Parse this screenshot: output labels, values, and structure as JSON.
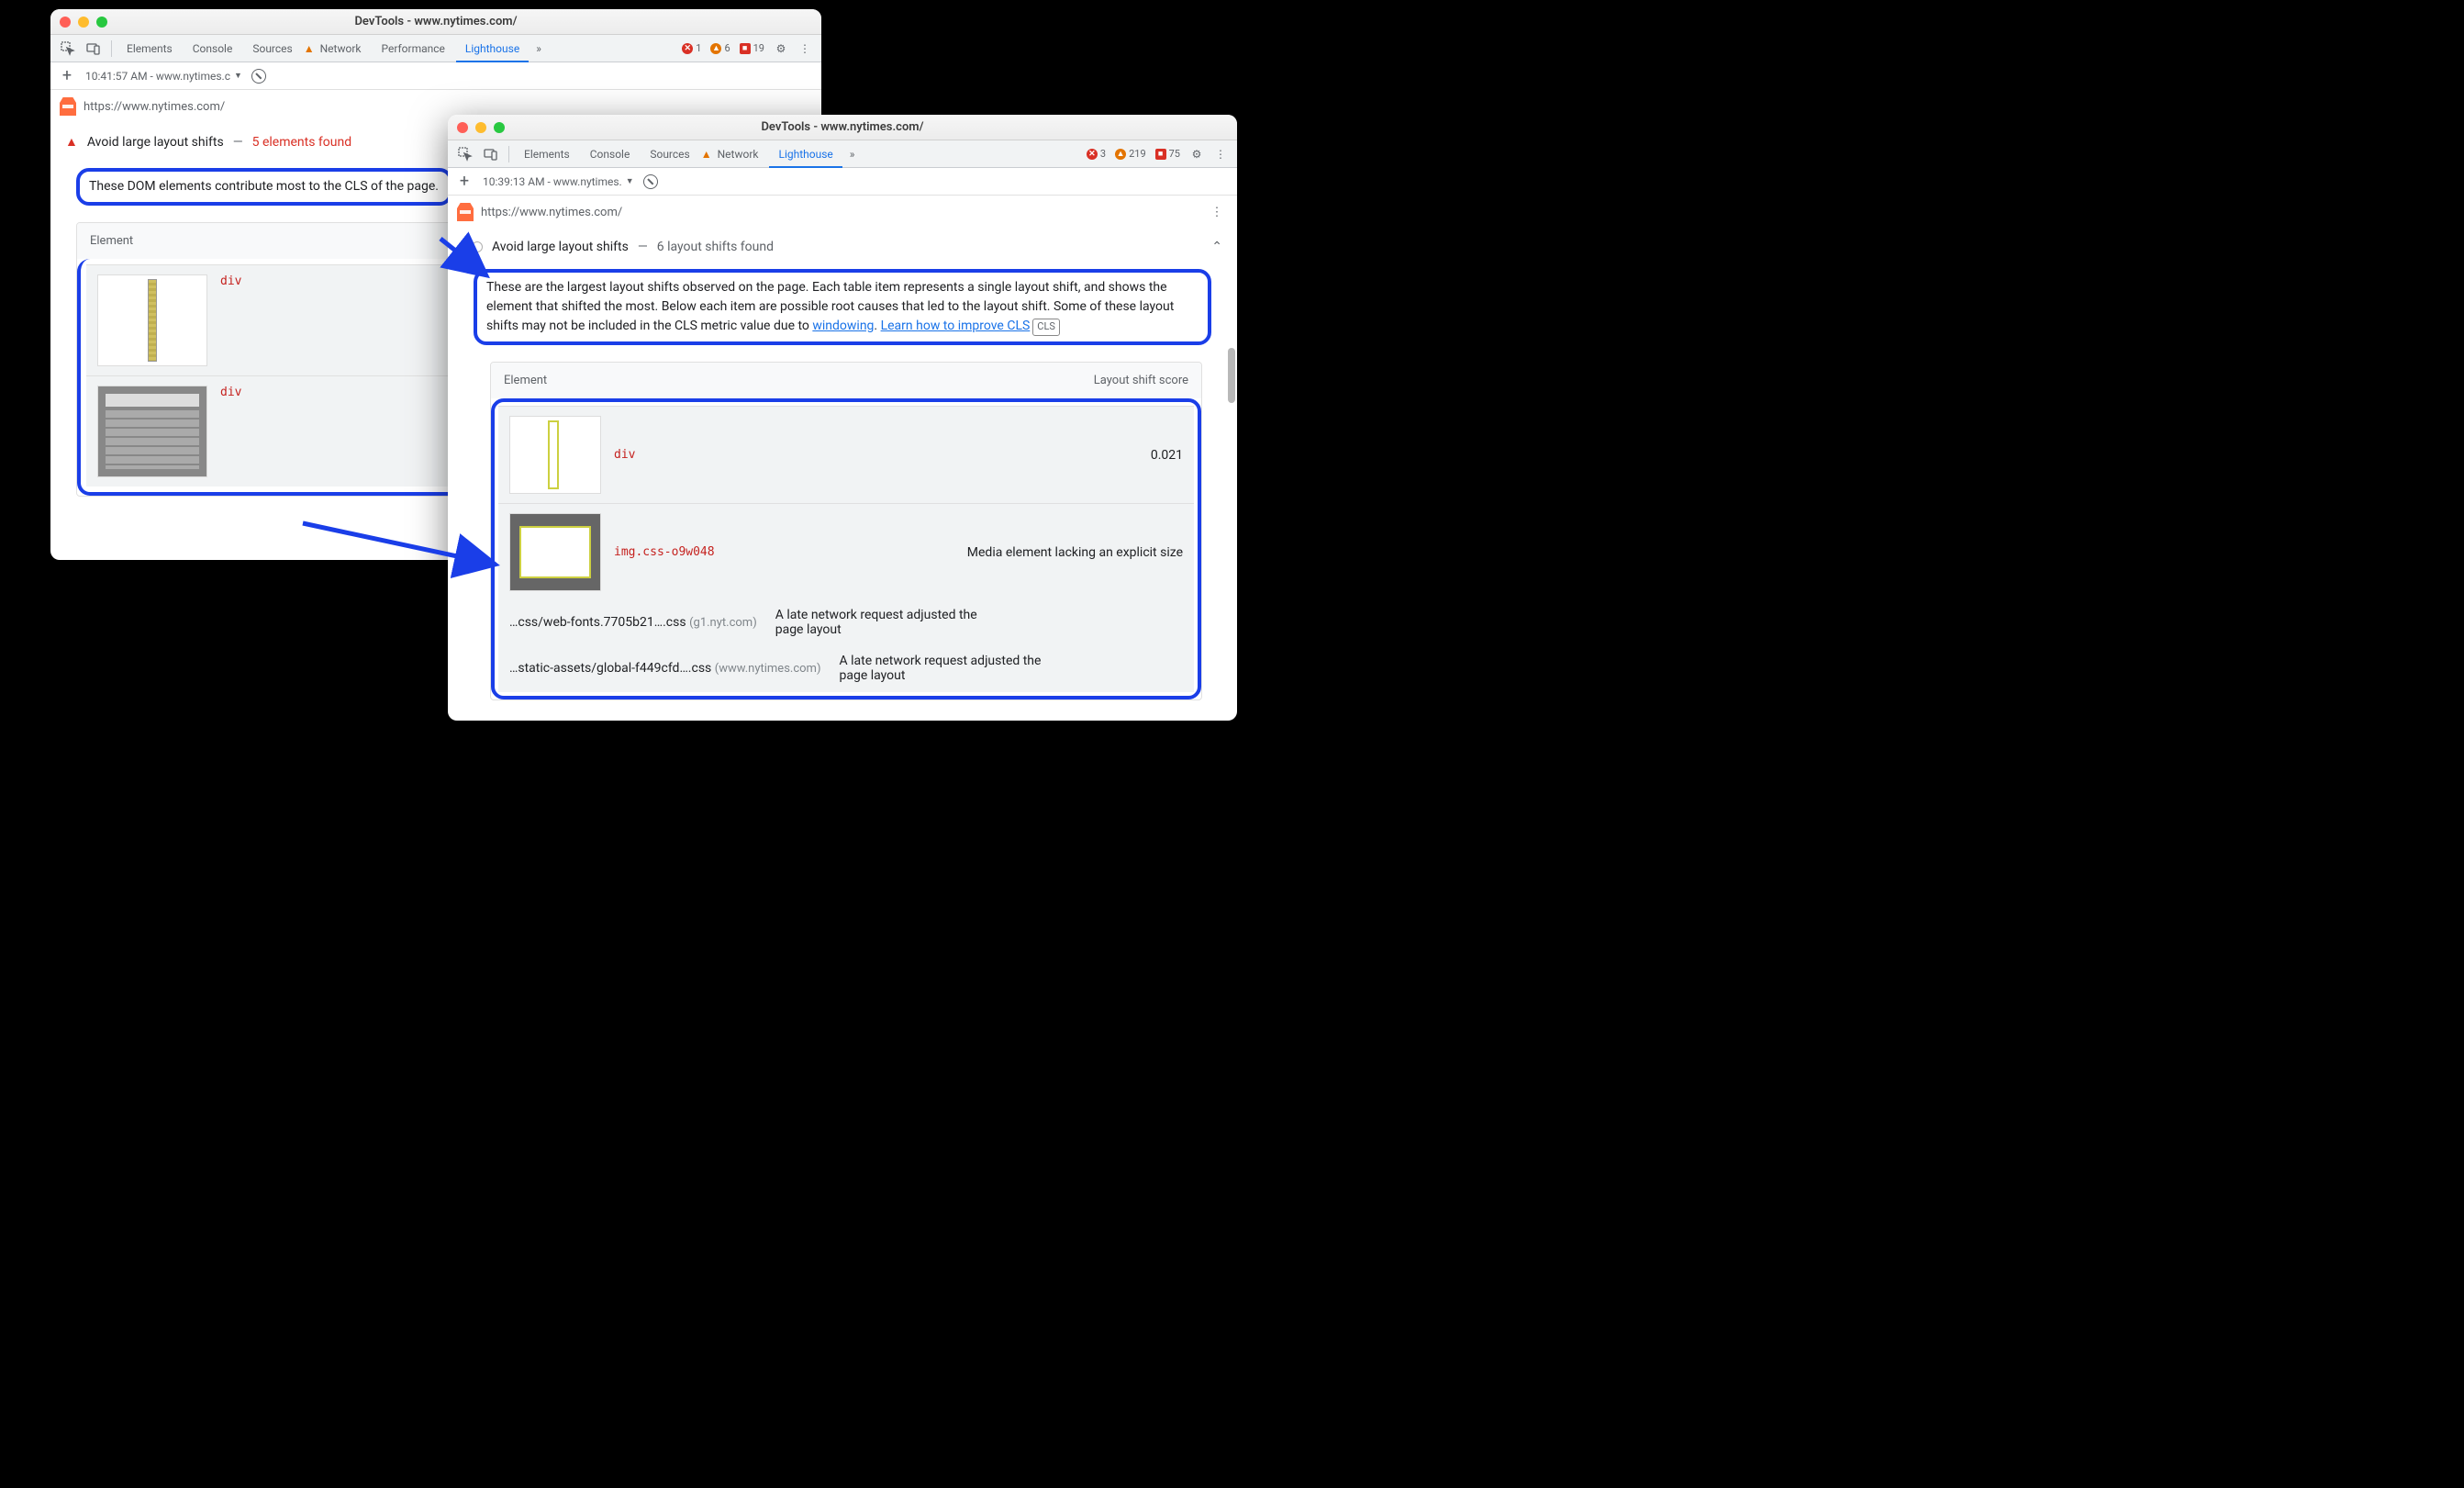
{
  "win1": {
    "title": "DevTools - www.nytimes.com/",
    "tabs": {
      "elements": "Elements",
      "console": "Console",
      "sources": "Sources",
      "network": "Network",
      "performance": "Performance",
      "lighthouse": "Lighthouse"
    },
    "status": {
      "err": "1",
      "warn": "6",
      "iss": "19"
    },
    "subbar": {
      "timestamp": "10:41:57 AM - www.nytimes.c"
    },
    "url": "https://www.nytimes.com/",
    "audit": {
      "icon": "▲",
      "title": "Avoid large layout shifts",
      "found": "5 elements found"
    },
    "description": "These DOM elements contribute most to the CLS of the page.",
    "colhead": "Element",
    "rows": [
      {
        "code": "div"
      },
      {
        "code": "div"
      }
    ]
  },
  "win2": {
    "title": "DevTools - www.nytimes.com/",
    "tabs": {
      "elements": "Elements",
      "console": "Console",
      "sources": "Sources",
      "network": "Network",
      "lighthouse": "Lighthouse"
    },
    "status": {
      "err": "3",
      "warn": "219",
      "iss": "75"
    },
    "subbar": {
      "timestamp": "10:39:13 AM - www.nytimes."
    },
    "url": "https://www.nytimes.com/",
    "audit": {
      "title": "Avoid large layout shifts",
      "found": "6 layout shifts found"
    },
    "description": "These are the largest layout shifts observed on the page. Each table item represents a single layout shift, and shows the element that shifted the most. Below each item are possible root causes that led to the layout shift. Some of these layout shifts may not be included in the CLS metric value due to ",
    "link1": "windowing",
    "desc_mid": ". ",
    "link2": "Learn how to improve CLS",
    "chip": "CLS",
    "cols": {
      "el": "Element",
      "score": "Layout shift score"
    },
    "row1": {
      "code": "div",
      "score": "0.021"
    },
    "row2": {
      "code": "img.css-o9w048",
      "cause1": "Media element lacking an explicit size",
      "file2": "…css/web-fonts.7705b21….css",
      "host2": "(g1.nyt.com)",
      "cause2": "A late network request adjusted the page layout",
      "file3": "…static-assets/global-f449cfd….css",
      "host3": "(www.nytimes.com)",
      "cause3": "A late network request adjusted the page layout"
    }
  }
}
